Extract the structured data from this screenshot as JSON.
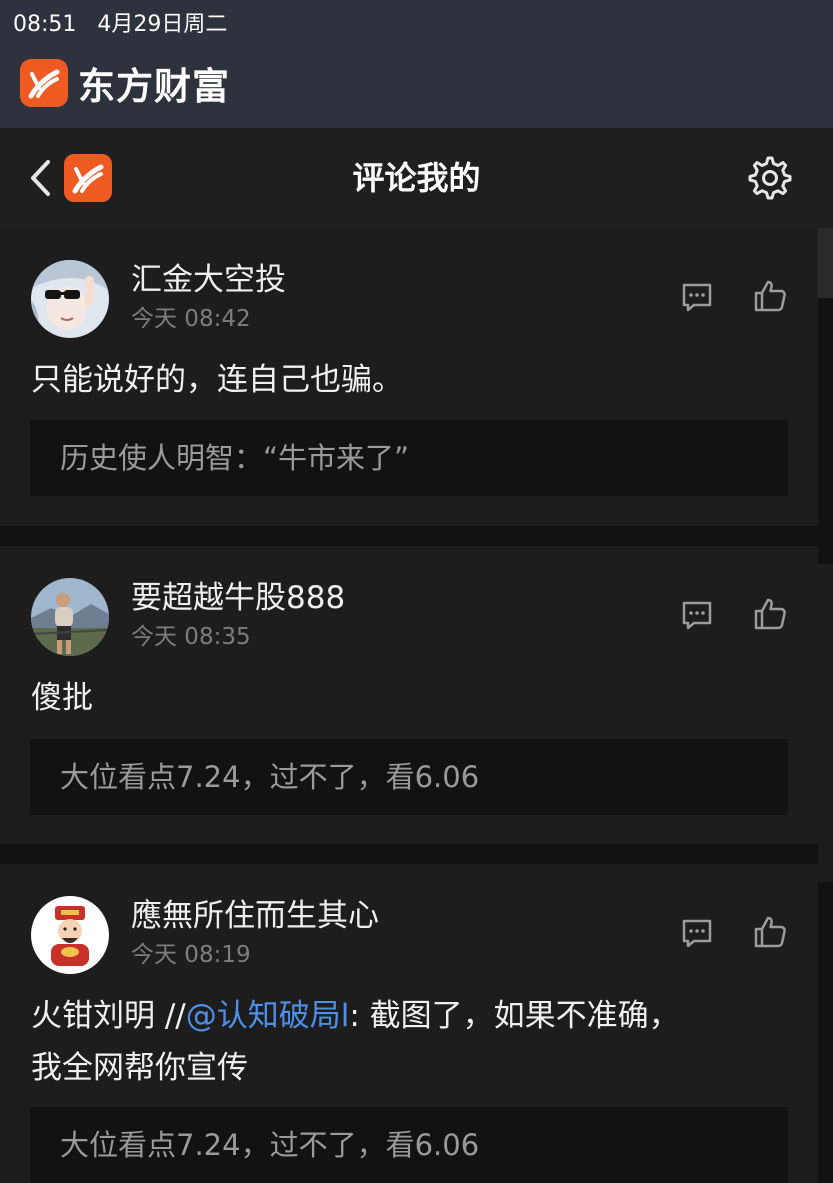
{
  "status_bar": {
    "time": "08:51",
    "date": "4月29日周二"
  },
  "app": {
    "name": "东方财富",
    "brand_color": "#ef5a23"
  },
  "nav": {
    "title": "评论我的",
    "back_icon": "chevron-left-icon",
    "settings_icon": "gear-icon"
  },
  "comments": [
    {
      "author": "汇金大空投",
      "time": "今天 08:42",
      "text": "只能说好的，连自己也骗。",
      "quoted": "历史使人明智：“牛市来了”"
    },
    {
      "author": "要超越牛股888",
      "time": "今天 08:35",
      "text": "傻批",
      "quoted": "大位看点7.24，过不了，看6.06"
    },
    {
      "author": "應無所住而生其心",
      "time": "今天 08:19",
      "text_prefix": "火钳刘明 //",
      "mention": "@认知破局l",
      "text_suffix": ": 截图了，如果不准确，",
      "text_line2": "我全网帮你宣传",
      "quoted": "大位看点7.24，过不了，看6.06"
    }
  ],
  "colors": {
    "background": "#111111",
    "card": "#1d1d1d",
    "quote_bg": "#121212",
    "mention": "#4f8fe8",
    "status_bar": "#2d323c"
  }
}
